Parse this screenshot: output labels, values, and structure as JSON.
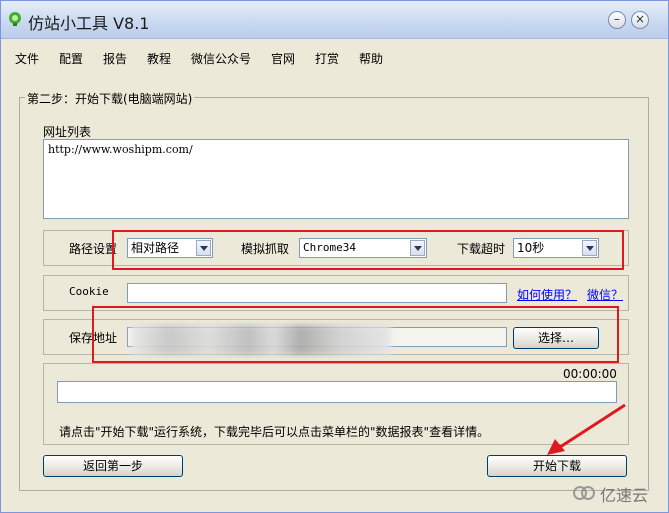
{
  "window": {
    "title": "仿站小工具 V8.1",
    "controls": {
      "minimize": "–",
      "close": "×"
    }
  },
  "menu": [
    "文件",
    "配置",
    "报告",
    "教程",
    "微信公众号",
    "官网",
    "打赏",
    "帮助"
  ],
  "group_title": "第二步：开始下载(电脑端网站)",
  "url_list": {
    "label": "网址列表",
    "value": "http://www.woshipm.com/"
  },
  "options": {
    "path_label": "路径设置",
    "path_value": "相对路径",
    "emulate_label": "模拟抓取",
    "emulate_value": "Chrome34",
    "timeout_label": "下载超时",
    "timeout_value": "10秒"
  },
  "cookie": {
    "label": "Cookie",
    "value": "",
    "how_to_link": "如何使用？",
    "wechat_link": "微信？"
  },
  "save": {
    "label": "保存地址",
    "choose_button": "选择…"
  },
  "progress": {
    "time": "00:00:00",
    "fraction": 0
  },
  "status_text": "请点击\"开始下载\"运行系统，下载完毕后可以点击菜单栏的\"数据报表\"查看详情。",
  "buttons": {
    "back": "返回第一步",
    "start": "开始下载"
  },
  "watermark": "亿速云",
  "colors": {
    "highlight": "#e0191f",
    "link": "#0000ff"
  }
}
